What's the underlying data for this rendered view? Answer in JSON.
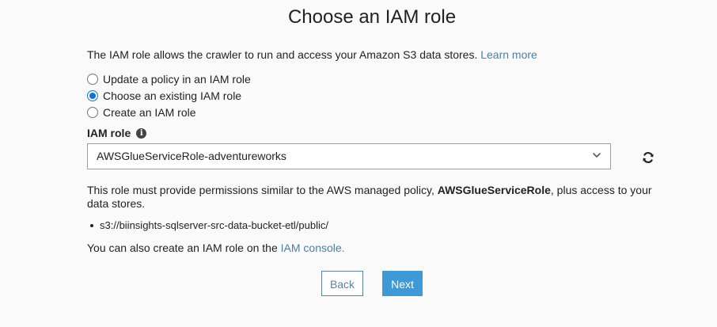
{
  "page": {
    "title": "Choose an IAM role",
    "intro_text": "The IAM role allows the crawler to run and access your Amazon S3 data stores.",
    "learn_more": "Learn more"
  },
  "options": [
    {
      "label": "Update a policy in an IAM role",
      "selected": false
    },
    {
      "label": "Choose an existing IAM role",
      "selected": true
    },
    {
      "label": "Create an IAM role",
      "selected": false
    }
  ],
  "iam_role": {
    "label": "IAM role",
    "info_glyph": "i",
    "selected_value": "AWSGlueServiceRole-adventureworks"
  },
  "description": {
    "text_before": "This role must provide permissions similar to the AWS managed policy,",
    "policy_name": "AWSGlueServiceRole",
    "text_after": ", plus access to your data stores."
  },
  "data_stores": [
    "s3://biinsights-sqlserver-src-data-bucket-etl/public/"
  ],
  "also_create": {
    "text": "You can also create an IAM role on the",
    "link": "IAM console."
  },
  "buttons": {
    "back": "Back",
    "next": "Next"
  },
  "colors": {
    "link": "#4a7fa8",
    "radio_selected": "#0f73d4",
    "primary_button": "#3d9ad6",
    "secondary_button_border": "#5a83a8",
    "background": "#fafafa"
  },
  "icons": {
    "info": "info-icon",
    "dropdown": "chevron-down-icon",
    "refresh": "refresh-icon"
  }
}
